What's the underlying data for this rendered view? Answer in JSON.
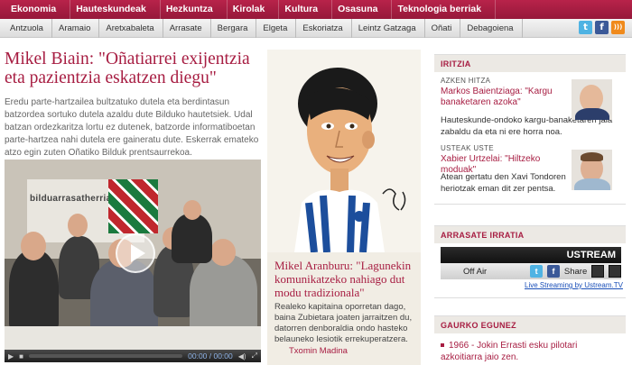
{
  "topnav": [
    "Ekonomia",
    "Hauteskundeak",
    "Hezkuntza",
    "Kirolak",
    "Kultura",
    "Osasuna",
    "Teknologia berriak"
  ],
  "subnav": [
    "Antzuola",
    "Aramaio",
    "Aretxabaleta",
    "Arrasate",
    "Bergara",
    "Elgeta",
    "Eskoriatza",
    "Leintz Gatzaga",
    "Oñati",
    "Debagoiena"
  ],
  "social": {
    "twitter_icon": "t",
    "facebook_icon": "f",
    "rss_icon": "rss"
  },
  "main": {
    "headline": "Mikel Biain: \"Oñatiarrei exijentzia eta pazientzia eskatzen diegu\"",
    "lede": "Eredu parte-hartzailea bultzatuko dutela eta berdintasun batzordea sortuko dutela azaldu dute Bilduko hautetsiek. Udal batzan ordezkaritza lortu ez dutenek, batzorde informatiboetan parte-hartzea nahi dutela ere gaineratu dute. Eskerrak emateko atzo egin zuten Oñatiko Bilduk prentsaurrekoa.",
    "video": {
      "poster_text": "bilduarrasatherria",
      "time": "00:00 / 00:00"
    }
  },
  "center": {
    "title": "Mikel Aranburu: \"Lagunekin komunikatzeko nahiago dut modu tradizionala\"",
    "text": "Realeko kapitaina oporretan dago, baina Zubietara joaten jarraitzen du, datorren denboraldia ondo hasteko belauneko lesiotik errekuperatzera.",
    "author": "Txomin Madina"
  },
  "sidebar": {
    "iritzia": {
      "heading": "IRITZIA",
      "items": [
        {
          "label": "AZKEN HITZA",
          "link": "Markos Baientziaga: \"Kargu banaketaren azoka\"",
          "text": "Hauteskunde-ondoko kargu-banaketaren jaia zabaldu da eta ni ere horra noa."
        },
        {
          "label": "USTEAK USTE",
          "link": "Xabier Urtzelai: \"Hiltzeko moduak\"",
          "text": "Atean gertatu den Xavi Tondoren heriotzak eman dit zer pentsa."
        }
      ]
    },
    "irratia": {
      "heading": "ARRASATE IRRATIA",
      "ustream_logo": "USTREAM",
      "off_air": "Off Air",
      "share": "Share",
      "live_link": "Live Streaming by Ustream.TV"
    },
    "gaurko": {
      "heading": "GAURKO EGUNEZ",
      "item": "1966 - Jokin Errasti esku pilotari azkoitiarra jaio zen."
    }
  },
  "colors": {
    "brand": "#a71d42",
    "nav_bg": "#a31e45"
  }
}
